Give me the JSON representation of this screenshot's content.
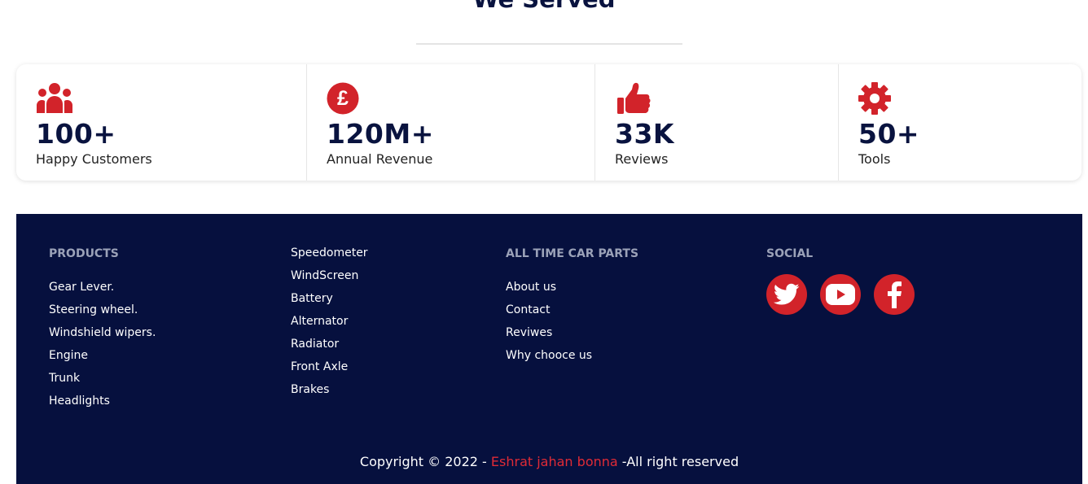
{
  "section": {
    "title": "We Served"
  },
  "stats": [
    {
      "icon": "users-icon",
      "value": "100+",
      "label": "Happy Customers"
    },
    {
      "icon": "pound-sign-icon",
      "value": "120M+",
      "label": "Annual Revenue"
    },
    {
      "icon": "thumbs-up-icon",
      "value": "33K",
      "label": "Reviews"
    },
    {
      "icon": "gear-icon",
      "value": "50+",
      "label": "Tools"
    }
  ],
  "footer": {
    "products": {
      "heading": "PRODUCTS",
      "items": [
        "Gear Lever.",
        "Steering wheel.",
        "Windshield wipers.",
        "Engine",
        "Trunk",
        "Headlights"
      ]
    },
    "more_products": {
      "items": [
        "Speedometer",
        "WindScreen",
        "Battery",
        "Alternator",
        "Radiator",
        "Front Axle",
        "Brakes"
      ]
    },
    "company": {
      "heading": "ALL TIME CAR PARTS",
      "items": [
        "About us",
        "Contact",
        "Reviwes",
        "Why chooce us"
      ]
    },
    "social": {
      "heading": "SOCIAL",
      "icons": [
        "twitter-icon",
        "youtube-icon",
        "facebook-icon"
      ]
    },
    "copyright": {
      "prefix": "Copyright © 2022 - ",
      "author": "Eshrat jahan bonna",
      "suffix": " -All right reserved"
    }
  },
  "colors": {
    "accent": "#d2232a",
    "navy": "#06103e",
    "heading_text": "#09133f"
  }
}
